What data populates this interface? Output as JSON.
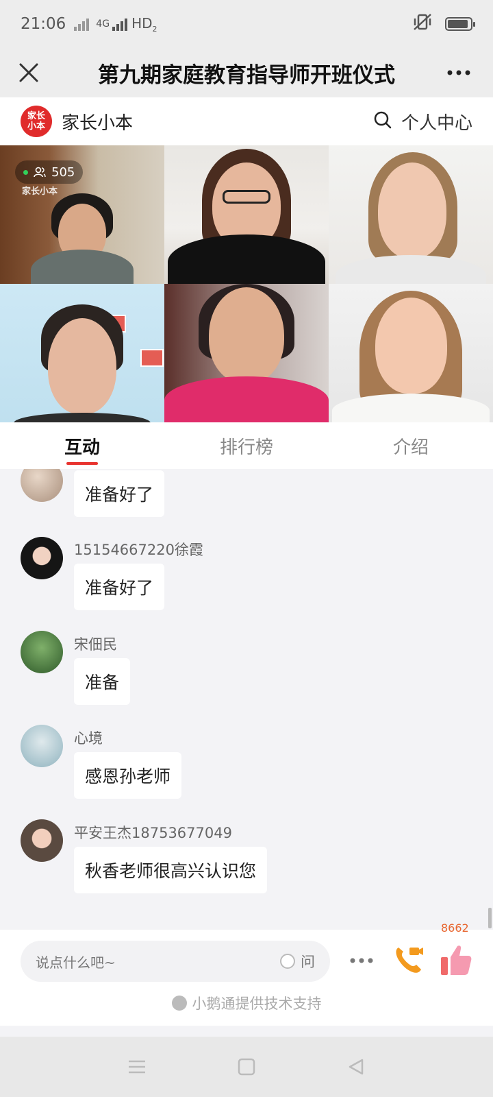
{
  "status_bar": {
    "time": "21:06",
    "network": "4G",
    "hd": "HD",
    "hd_sub": "2",
    "battery_level": 0.9
  },
  "header": {
    "title": "第九期家庭教育指导师开班仪式"
  },
  "channel": {
    "logo_text": "家长小本",
    "name": "家长小本",
    "center_label": "个人中心"
  },
  "video": {
    "viewer_count": "505",
    "watermark": "家长小本"
  },
  "tabs": [
    {
      "label": "互动",
      "active": true
    },
    {
      "label": "排行榜",
      "active": false
    },
    {
      "label": "介绍",
      "active": false
    }
  ],
  "messages": [
    {
      "user": "",
      "text": "准备好了"
    },
    {
      "user": "15154667220徐霞",
      "text": "准备好了"
    },
    {
      "user": "宋佃民",
      "text": "准备"
    },
    {
      "user": "心境",
      "text": "感恩孙老师"
    },
    {
      "user": "平安王杰18753677049",
      "text": "秋香老师很高兴认识您"
    }
  ],
  "input": {
    "placeholder": "说点什么吧~",
    "ask_label": "问"
  },
  "like_count": "8662",
  "support_text": "小鹅通提供技术支持",
  "colors": {
    "accent": "#e8332f",
    "call": "#f39a1e",
    "like": "#f06a6a"
  }
}
